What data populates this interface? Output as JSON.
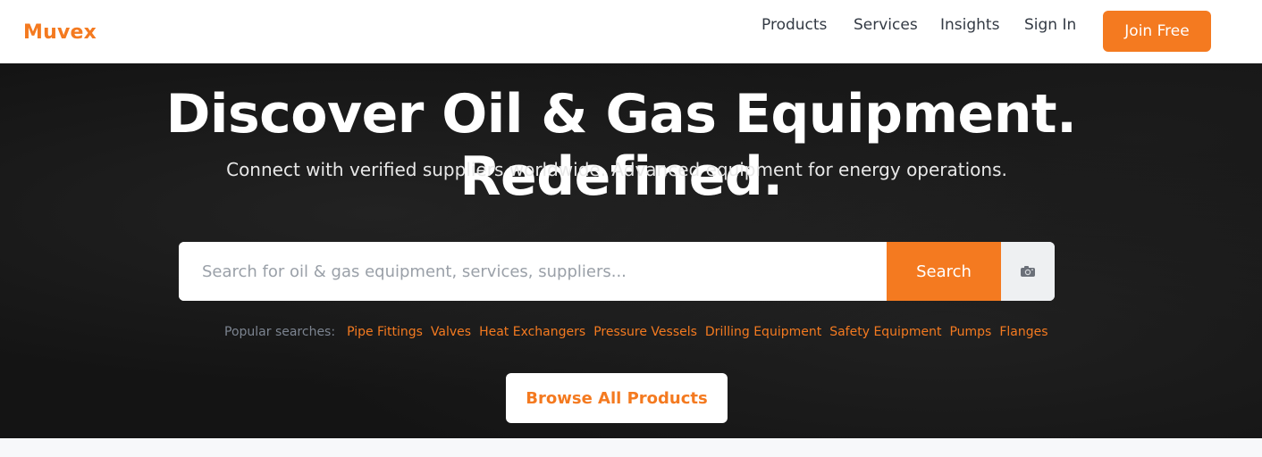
{
  "brand": {
    "name": "Muvex",
    "accent_color": "#f47a20"
  },
  "nav": {
    "items": [
      {
        "label": "Products"
      },
      {
        "label": "Services"
      },
      {
        "label": "Insights"
      },
      {
        "label": "Sign In"
      }
    ],
    "cta_label": "Join Free"
  },
  "hero": {
    "title": "Discover Oil & Gas Equipment. Redefined.",
    "subtitle": "Connect with verified suppliers worldwide. Advanced equipment for energy operations."
  },
  "search": {
    "placeholder": "Search for oil & gas equipment, services, suppliers...",
    "value": "",
    "button_label": "Search",
    "camera_icon": "camera-icon"
  },
  "popular": {
    "label": "Popular searches:",
    "items": [
      "Pipe Fittings",
      "Valves",
      "Heat Exchangers",
      "Pressure Vessels",
      "Drilling Equipment",
      "Safety Equipment",
      "Pumps",
      "Flanges"
    ]
  },
  "browse": {
    "label": "Browse All Products"
  }
}
